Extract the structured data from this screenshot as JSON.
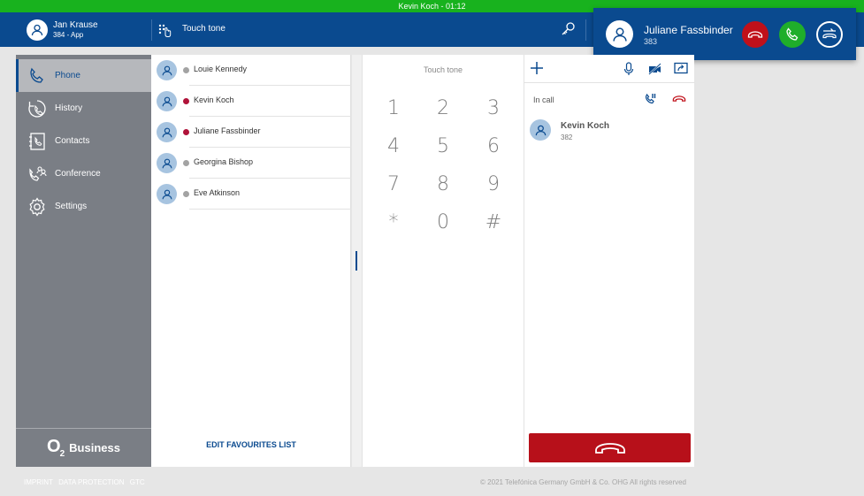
{
  "call_bar": {
    "text": "Kevin Koch - 01:12"
  },
  "header": {
    "user_name": "Jan Krause",
    "user_sub": "384 - App",
    "touch_tone_label": "Touch tone",
    "icons": {
      "user": "user-icon",
      "touch_tone": "touch-tone-icon",
      "key": "key-icon"
    }
  },
  "incoming_call": {
    "name": "Juliane Fassbinder",
    "number": "383",
    "colors": {
      "decline": "#c0101a",
      "accept": "#1fae2a"
    }
  },
  "sidebar": {
    "items": [
      {
        "label": "Phone",
        "icon": "phone-icon",
        "active": true
      },
      {
        "label": "History",
        "icon": "history-icon",
        "active": false
      },
      {
        "label": "Contacts",
        "icon": "contacts-icon",
        "active": false
      },
      {
        "label": "Conference",
        "icon": "conference-icon",
        "active": false
      },
      {
        "label": "Settings",
        "icon": "settings-icon",
        "active": false
      }
    ],
    "brand": {
      "o2": "O",
      "o2_sub": "2",
      "business": "Business"
    }
  },
  "favourites": {
    "items": [
      {
        "name": "Louie Kennedy",
        "status_color": "#a3a3a3"
      },
      {
        "name": "Kevin Koch",
        "status_color": "#b0133a"
      },
      {
        "name": "Juliane Fassbinder",
        "status_color": "#b0133a"
      },
      {
        "name": "Georgina Bishop",
        "status_color": "#a3a3a3"
      },
      {
        "name": "Eve Atkinson",
        "status_color": "#a3a3a3"
      }
    ],
    "edit_label": "EDIT FAVOURITES LIST"
  },
  "keypad": {
    "title": "Touch tone",
    "keys": [
      "1",
      "2",
      "3",
      "4",
      "5",
      "6",
      "7",
      "8",
      "9",
      "*",
      "0",
      "#"
    ]
  },
  "calls": {
    "in_call_label": "In call",
    "active_call": {
      "name": "Kevin Koch",
      "number": "382"
    },
    "icons": [
      "add-icon",
      "microphone-icon",
      "video-off-icon",
      "share-screen-icon",
      "hold-icon",
      "hangup-icon"
    ]
  },
  "footer": {
    "links": [
      "IMPRINT",
      "DATA PROTECTION",
      "GTC"
    ],
    "copyright": "© 2021 Telefónica Germany GmbH & Co. OHG All rights reserved"
  },
  "colors": {
    "primary": "#0a4a8f",
    "call_bar": "#18b21e",
    "sidebar": "#7a7e85",
    "hangup": "#b7101a"
  }
}
